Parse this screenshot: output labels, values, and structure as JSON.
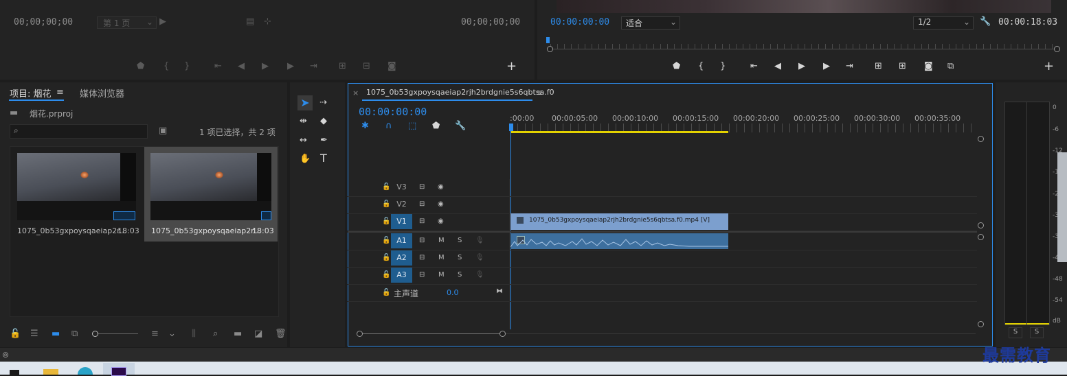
{
  "source_monitor": {
    "timecode_left": "00;00;00;00",
    "page_select": "第 1 页",
    "timecode_right": "00;00;00;00"
  },
  "program_monitor": {
    "timecode": "00:00:00:00",
    "fit_select": "适合",
    "resolution_select": "1/2",
    "duration": "00:00:18:03"
  },
  "project_panel": {
    "tab_project": "项目: 烟花",
    "tab_media": "媒体浏览器",
    "project_file": "烟花.prproj",
    "search_placeholder": "",
    "selection_info": "1 项已选择，共 2 项",
    "items": [
      {
        "name": "1075_0b53gxpoysqaeiap2r...",
        "duration": "18:03"
      },
      {
        "name": "1075_0b53gxpoysqaeiap2r...",
        "duration": "18:03"
      }
    ]
  },
  "timeline": {
    "sequence_name": "1075_0b53gxpoysqaeiap2rjh2brdgnie5s6qbtsa.f0",
    "timecode": "00:00:00:00",
    "ruler": [
      ":00:00",
      "00:00:05:00",
      "00:00:10:00",
      "00:00:15:00",
      "00:00:20:00",
      "00:00:25:00",
      "00:00:30:00",
      "00:00:35:00"
    ],
    "video_tracks": [
      "V3",
      "V2",
      "V1"
    ],
    "audio_tracks": [
      "A1",
      "A2",
      "A3"
    ],
    "mute_label": "M",
    "solo_label": "S",
    "master_label": "主声道",
    "master_value": "0.0",
    "video_clip_label": "1075_0b53gxpoysqaeiap2rjh2brdgnie5s6qbtsa.f0.mp4 [V]"
  },
  "audio_meter": {
    "scale": [
      "0",
      "-6",
      "-12",
      "-18",
      "-24",
      "-30",
      "-36",
      "-42",
      "-48",
      "-54",
      "dB"
    ],
    "solo_left": "S",
    "solo_right": "S"
  },
  "watermark": "最需教育",
  "colors": {
    "accent": "#2d8ceb",
    "clip_video": "#7c9fce",
    "clip_audio": "#3d6f9e",
    "work_area": "#e3d200"
  }
}
